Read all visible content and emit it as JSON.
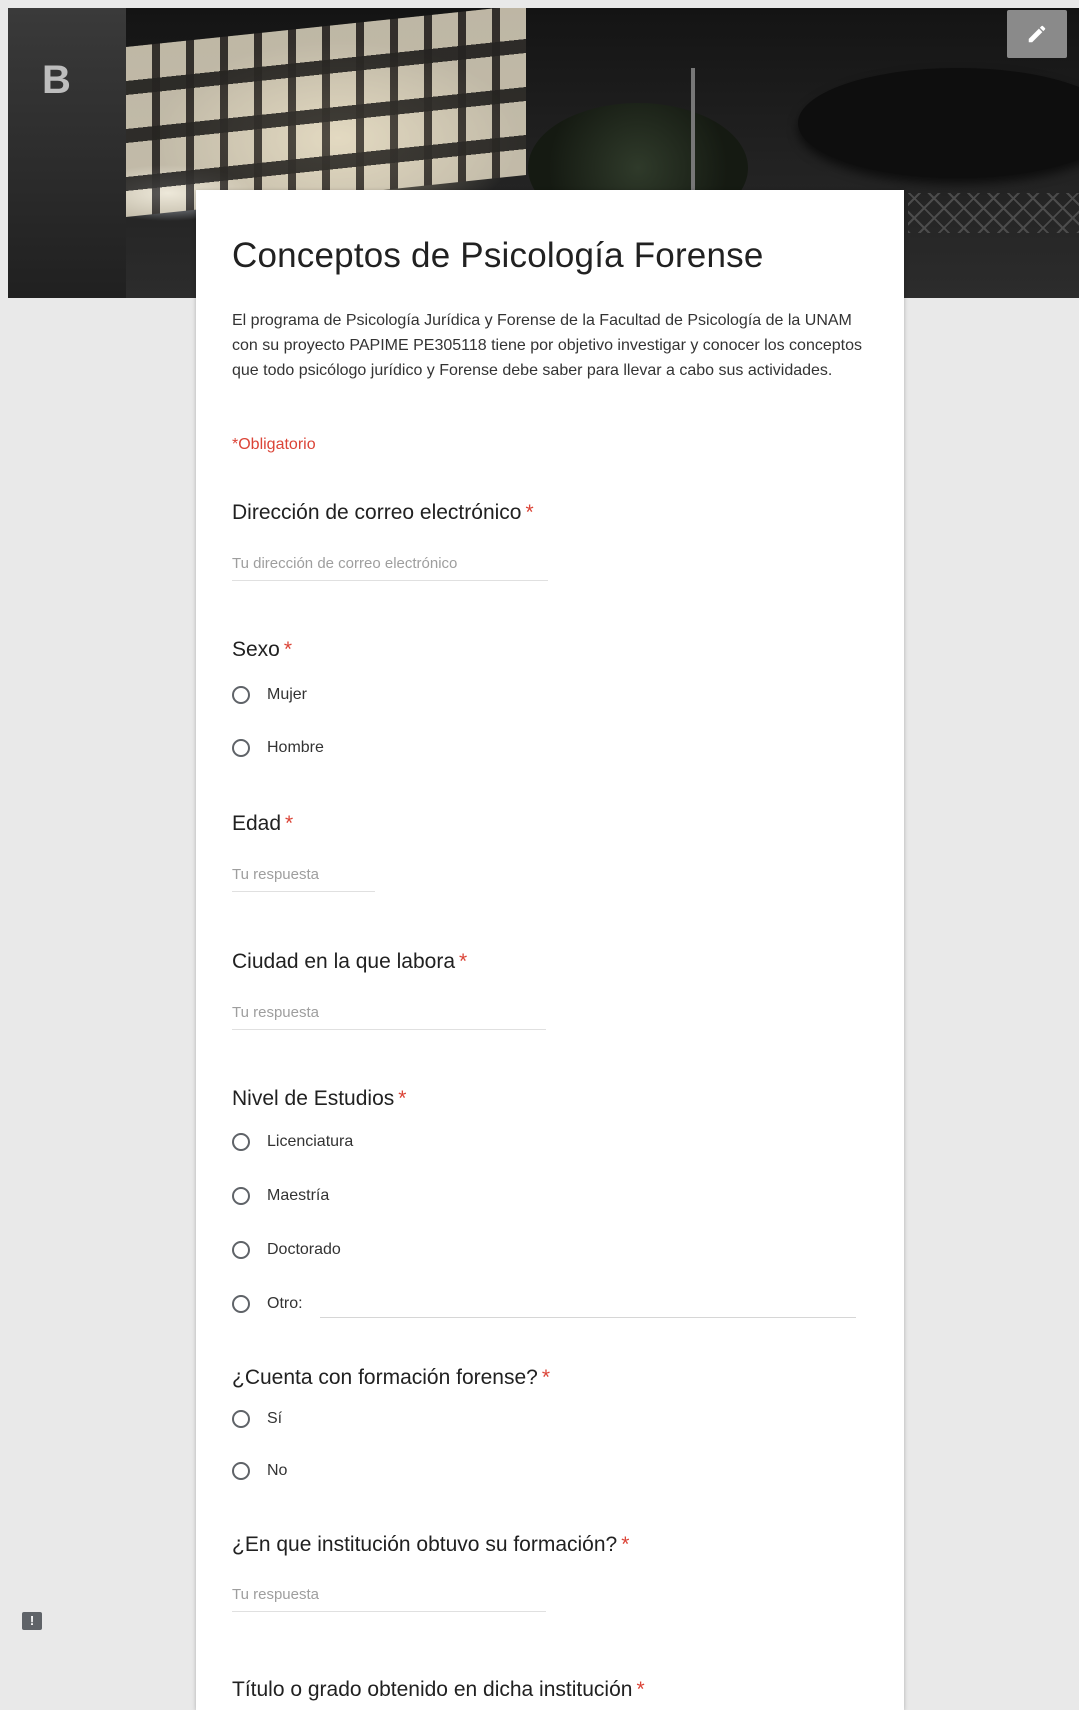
{
  "banner": {
    "building_letter": "B",
    "edit_icon": "pencil-icon"
  },
  "form": {
    "title": "Conceptos de Psicología Forense",
    "description": "El programa de Psicología Jurídica y Forense de la Facultad de Psicología de la UNAM con su proyecto PAPIME PE305118 tiene por objetivo investigar y conocer los conceptos que todo psicólogo jurídico y Forense debe saber para llevar a cabo sus actividades.",
    "required_note": "*Obligatorio"
  },
  "questions": {
    "email": {
      "label": "Dirección de correo electrónico",
      "star": "*",
      "placeholder": "Tu dirección de correo electrónico"
    },
    "sex": {
      "label": "Sexo",
      "star": "*",
      "options": [
        "Mujer",
        "Hombre"
      ]
    },
    "age": {
      "label": "Edad",
      "star": "*",
      "placeholder": "Tu respuesta"
    },
    "city": {
      "label": "Ciudad en la que labora",
      "star": "*",
      "placeholder": "Tu respuesta"
    },
    "education": {
      "label": "Nivel de Estudios",
      "star": "*",
      "options": [
        "Licenciatura",
        "Maestría",
        "Doctorado",
        "Otro:"
      ]
    },
    "forensic_training": {
      "label": "¿Cuenta con formación forense?",
      "star": "*",
      "options": [
        "Sí",
        "No"
      ]
    },
    "institution": {
      "label": "¿En que institución obtuvo su formación?",
      "star": "*",
      "placeholder": "Tu respuesta"
    },
    "degree": {
      "label": "Título o grado obtenido en dicha institución",
      "star": "*"
    }
  },
  "footer": {
    "feedback_icon": "feedback-icon",
    "feedback_glyph": "!"
  },
  "colors": {
    "required": "#db4437",
    "background": "#e9e9e9",
    "card": "#ffffff"
  }
}
